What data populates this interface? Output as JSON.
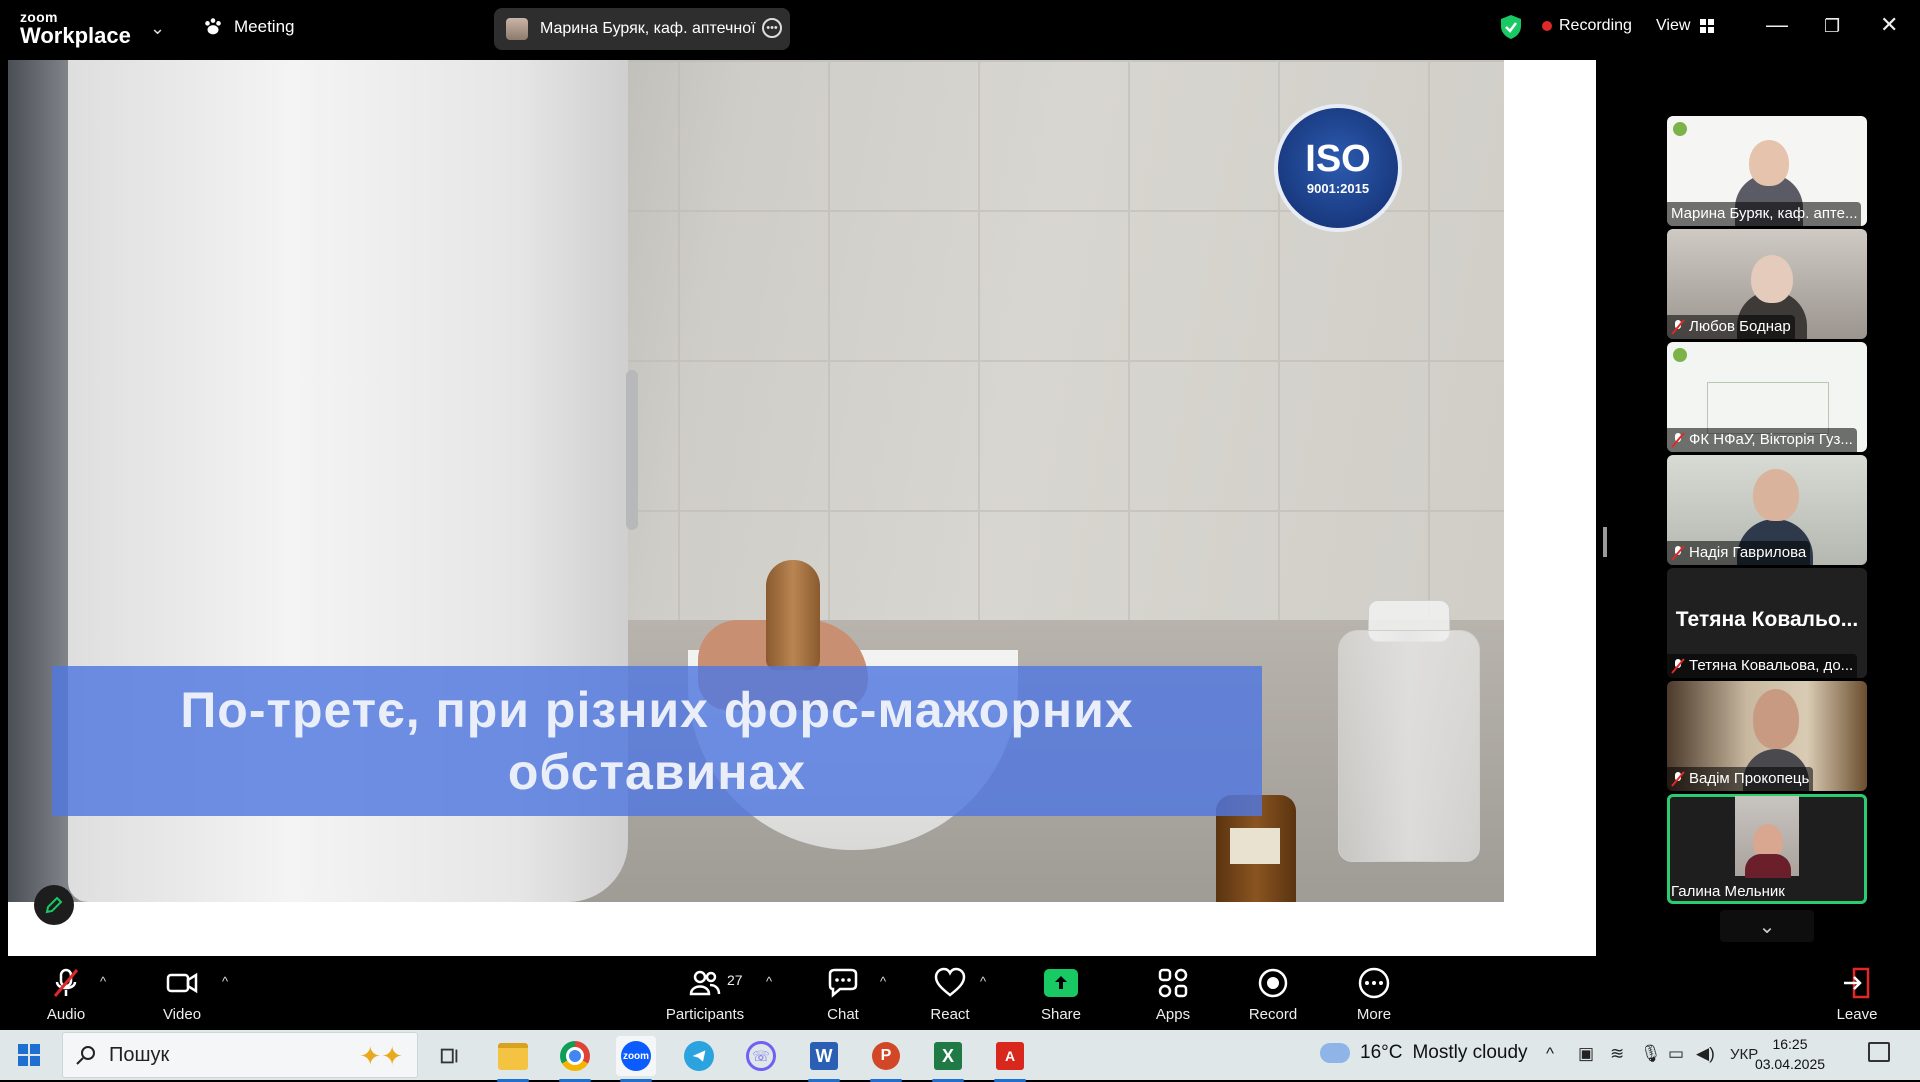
{
  "app": {
    "brand_small": "zoom",
    "brand_big": "Workplace",
    "meeting_label": "Meeting",
    "speaker_name": "Марина Буряк, каф. аптечної те",
    "recording_label": "Recording",
    "view_label": "View"
  },
  "shared_screen": {
    "iso_badge_main": "ISO",
    "iso_badge_sub": "9001:2015",
    "caption_line1": "По-третє, при різних форс-мажорних",
    "caption_line2": "обставинах"
  },
  "participants": [
    {
      "name": "Марина Буряк, каф. апте...",
      "muted": false
    },
    {
      "name": "Любов Боднар",
      "muted": true
    },
    {
      "name": "ФК НФаУ, Вікторія Гуз...",
      "muted": true
    },
    {
      "name": "Надія Гаврилова",
      "muted": true
    },
    {
      "name": "Тетяна Ковальова, до...",
      "display_name": "Тетяна  Ковальо...",
      "muted": true
    },
    {
      "name": "Вадім Прокопець",
      "muted": true
    },
    {
      "name": "Галина Мельник",
      "muted": false,
      "active": true
    }
  ],
  "toolbar": {
    "audio": "Audio",
    "video": "Video",
    "participants": "Participants",
    "participants_count": "27",
    "chat": "Chat",
    "react": "React",
    "share": "Share",
    "apps": "Apps",
    "record": "Record",
    "more": "More",
    "leave": "Leave"
  },
  "taskbar": {
    "search_placeholder": "Пошук",
    "weather_temp": "16°C",
    "weather_desc": "Mostly cloudy",
    "language": "УКР",
    "time": "16:25",
    "date": "03.04.2025"
  },
  "colors": {
    "active_speaker": "#2ecc71",
    "share_green": "#18c964",
    "recording_dot": "#e02828",
    "caption_bg": "#5078e1"
  }
}
